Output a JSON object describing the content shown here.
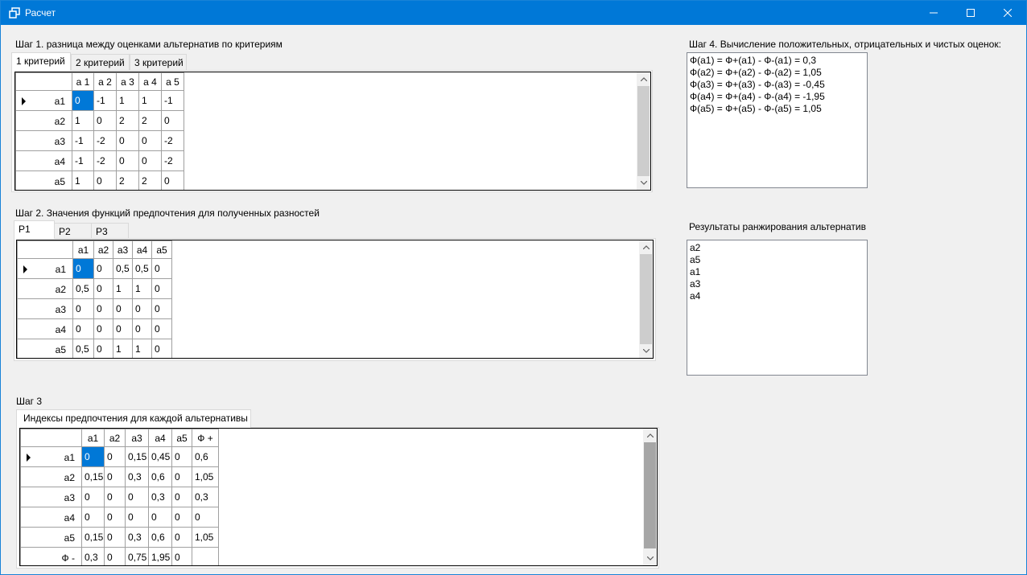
{
  "window": {
    "title": "Расчет"
  },
  "step1": {
    "heading": "Шаг 1. разница между оценками альтернатив по критериям",
    "tabs": [
      "1 критерий",
      "2 критерий",
      "3 критерий"
    ],
    "columns": [
      "а 1",
      "а 2",
      "а 3",
      "а 4",
      "а 5"
    ],
    "rows": [
      {
        "name": "а1",
        "cells": [
          "0",
          "-1",
          "1",
          "1",
          "-1"
        ]
      },
      {
        "name": "а2",
        "cells": [
          "1",
          "0",
          "2",
          "2",
          "0"
        ]
      },
      {
        "name": "а3",
        "cells": [
          "-1",
          "-2",
          "0",
          "0",
          "-2"
        ]
      },
      {
        "name": "а4",
        "cells": [
          "-1",
          "-2",
          "0",
          "0",
          "-2"
        ]
      },
      {
        "name": "а5",
        "cells": [
          "1",
          "0",
          "2",
          "2",
          "0"
        ]
      }
    ]
  },
  "step2": {
    "heading": "Шаг 2. Значения функций предпочтения для полученных разностей",
    "tabs": [
      "P1",
      "P2",
      "P3"
    ],
    "columns": [
      "а1",
      "а2",
      "а3",
      "а4",
      "а5"
    ],
    "rows": [
      {
        "name": "а1",
        "cells": [
          "0",
          "0",
          "0,5",
          "0,5",
          "0"
        ]
      },
      {
        "name": "а2",
        "cells": [
          "0,5",
          "0",
          "1",
          "1",
          "0"
        ]
      },
      {
        "name": "а3",
        "cells": [
          "0",
          "0",
          "0",
          "0",
          "0"
        ]
      },
      {
        "name": "а4",
        "cells": [
          "0",
          "0",
          "0",
          "0",
          "0"
        ]
      },
      {
        "name": "а5",
        "cells": [
          "0,5",
          "0",
          "1",
          "1",
          "0"
        ]
      }
    ]
  },
  "step3": {
    "heading": "Шаг 3",
    "tabs": [
      "Индексы предпочтения для каждой альтернативы"
    ],
    "columns": [
      "а1",
      "а2",
      "а3",
      "а4",
      "а5",
      "Ф +"
    ],
    "rows": [
      {
        "name": "а1",
        "cells": [
          "0",
          "0",
          "0,15",
          "0,45",
          "0",
          "0,6"
        ]
      },
      {
        "name": "а2",
        "cells": [
          "0,15",
          "0",
          "0,3",
          "0,6",
          "0",
          "1,05"
        ]
      },
      {
        "name": "а3",
        "cells": [
          "0",
          "0",
          "0",
          "0,3",
          "0",
          "0,3"
        ]
      },
      {
        "name": "а4",
        "cells": [
          "0",
          "0",
          "0",
          "0",
          "0",
          "0"
        ]
      },
      {
        "name": "а5",
        "cells": [
          "0,15",
          "0",
          "0,3",
          "0,6",
          "0",
          "1,05"
        ]
      },
      {
        "name": "Ф -",
        "cells": [
          "0,3",
          "0",
          "0,75",
          "1,95",
          "0",
          ""
        ]
      }
    ]
  },
  "step4": {
    "heading": "Шаг 4. Вычисление положительных, отрицательных и чистых оценок:",
    "lines": [
      "Ф(а1) = Ф+(а1) - Ф-(а1) = 0,3",
      "Ф(а2) = Ф+(а2) - Ф-(а2) = 1,05",
      "Ф(а3) = Ф+(а3) - Ф-(а3) = -0,45",
      "Ф(а4) = Ф+(а4) - Ф-(а4) = -1,95",
      "Ф(а5) = Ф+(а5) - Ф-(а5) = 1,05"
    ]
  },
  "ranking": {
    "heading": "Результаты ранжирования альтернатив",
    "items": [
      "а2",
      "а5",
      "а1",
      "а3",
      "а4"
    ]
  }
}
